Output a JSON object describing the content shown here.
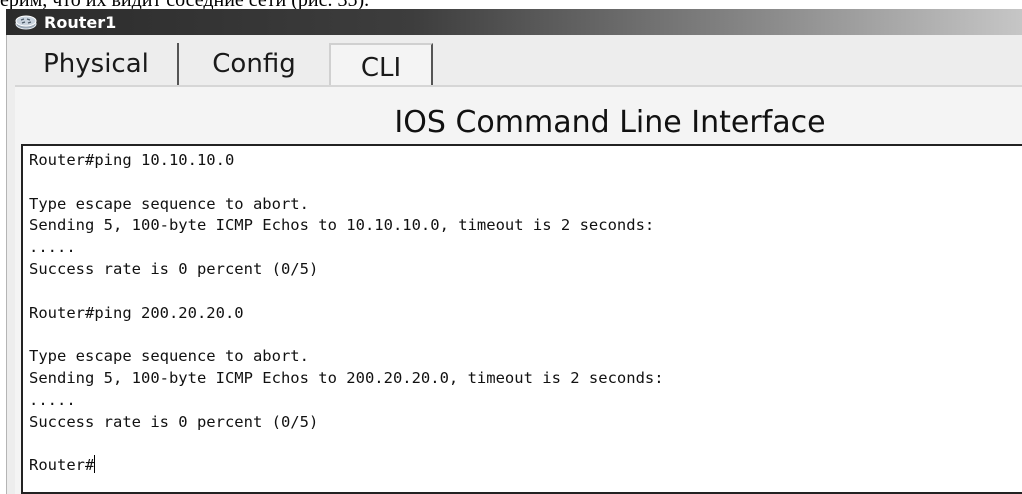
{
  "caption": "ерим, что их видит соседние сети (рис. 35).",
  "window": {
    "title": "Router1",
    "icon": "router-icon"
  },
  "tabs": [
    {
      "label": "Physical",
      "active": false
    },
    {
      "label": "Config",
      "active": false
    },
    {
      "label": "CLI",
      "active": true
    }
  ],
  "cli": {
    "heading": "IOS Command Line Interface",
    "lines": [
      "Router#ping 10.10.10.0",
      "",
      "Type escape sequence to abort.",
      "Sending 5, 100-byte ICMP Echos to 10.10.10.0, timeout is 2 seconds:",
      ".....",
      "Success rate is 0 percent (0/5)",
      "",
      "Router#ping 200.20.20.0",
      "",
      "Type escape sequence to abort.",
      "Sending 5, 100-byte ICMP Echos to 200.20.20.0, timeout is 2 seconds:",
      ".....",
      "Success rate is 0 percent (0/5)",
      "",
      "Router#"
    ]
  },
  "colors": {
    "titlebar_dark": "#2b2b2b",
    "titlebar_light": "#c6c6c6",
    "frame_bg": "#ededed",
    "terminal_bg": "#ffffff",
    "terminal_text": "#111111"
  }
}
